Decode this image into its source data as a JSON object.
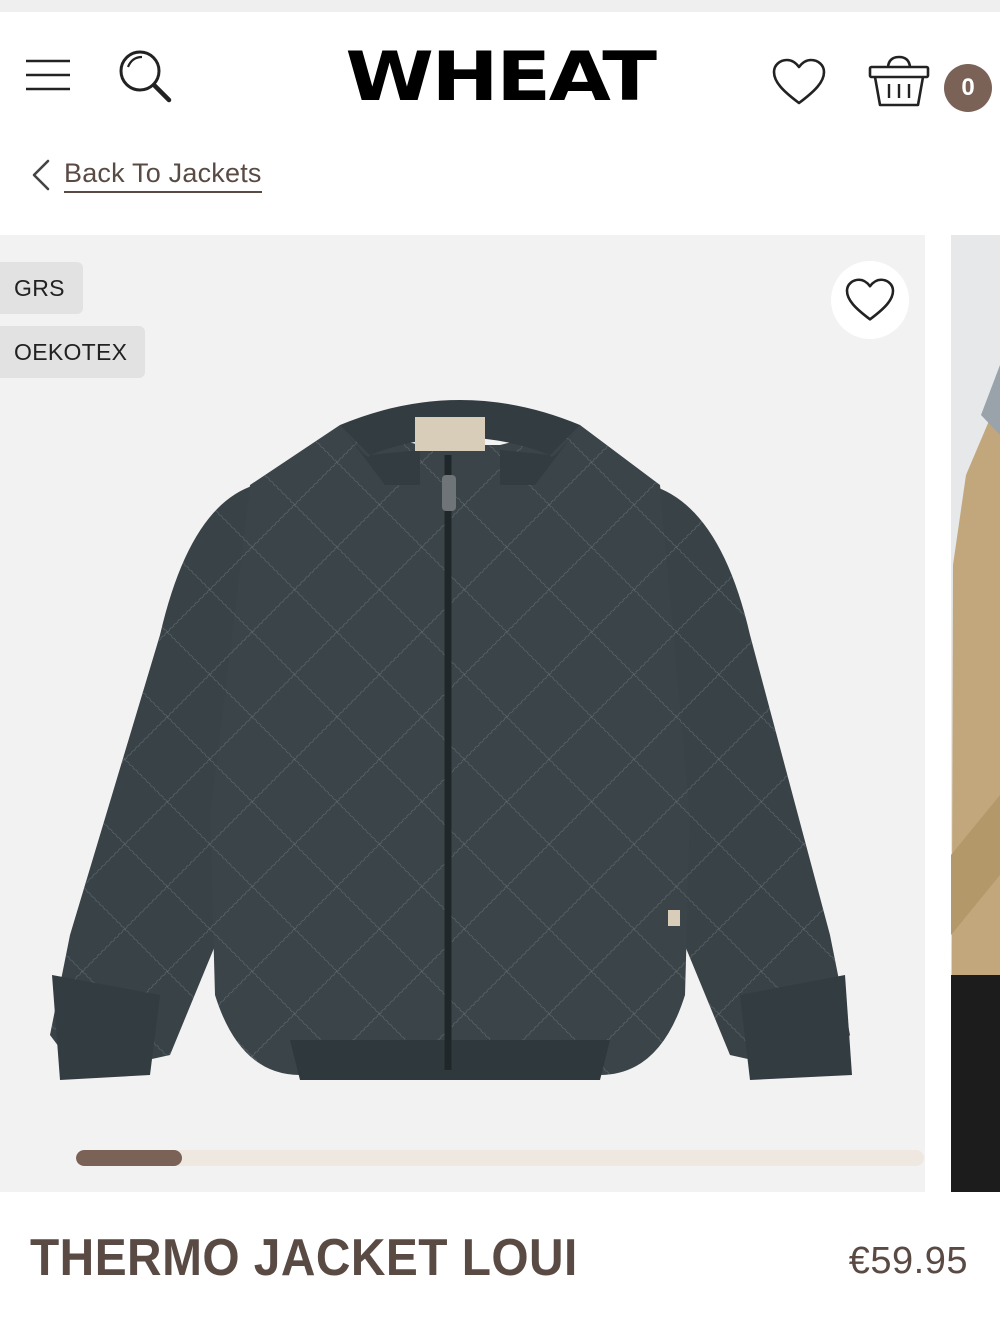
{
  "header": {
    "logo_text": "WHEAT",
    "cart_count": "0"
  },
  "nav": {
    "back_label": "Back To Jackets"
  },
  "gallery": {
    "badges": [
      "GRS",
      "OEKOTEX"
    ],
    "progress_fraction": 0.125
  },
  "product": {
    "title": "THERMO JACKET LOUI",
    "price": "€59.95"
  },
  "colors": {
    "accent": "#7a6257",
    "text_brown": "#5a4a44",
    "jacket": "#3b4449",
    "gallery_bg": "#f2f2f2"
  },
  "icons": {
    "menu": "hamburger-icon",
    "search": "search-icon",
    "wishlist": "heart-icon",
    "cart": "basket-icon",
    "back": "chevron-left-icon"
  }
}
